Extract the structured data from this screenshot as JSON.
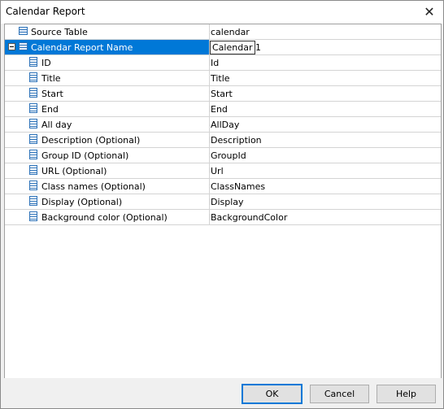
{
  "window": {
    "title": "Calendar Report",
    "close_glyph": "✕"
  },
  "rows": [
    {
      "label": "Source Table",
      "value": "calendar"
    },
    {
      "label": "Calendar Report Name",
      "value": "Calendar 1"
    },
    {
      "label": "ID",
      "value": "Id"
    },
    {
      "label": "Title",
      "value": "Title"
    },
    {
      "label": "Start",
      "value": "Start"
    },
    {
      "label": "End",
      "value": "End"
    },
    {
      "label": "All day",
      "value": "AllDay"
    },
    {
      "label": "Description (Optional)",
      "value": "Description"
    },
    {
      "label": "Group ID (Optional)",
      "value": "GroupId"
    },
    {
      "label": "URL (Optional)",
      "value": "Url"
    },
    {
      "label": "Class names (Optional)",
      "value": "ClassNames"
    },
    {
      "label": "Display (Optional)",
      "value": "Display"
    },
    {
      "label": "Background color (Optional)",
      "value": "BackgroundColor"
    }
  ],
  "buttons": {
    "ok": "OK",
    "cancel": "Cancel",
    "help": "Help"
  },
  "colors": {
    "selection": "#0078d7"
  }
}
